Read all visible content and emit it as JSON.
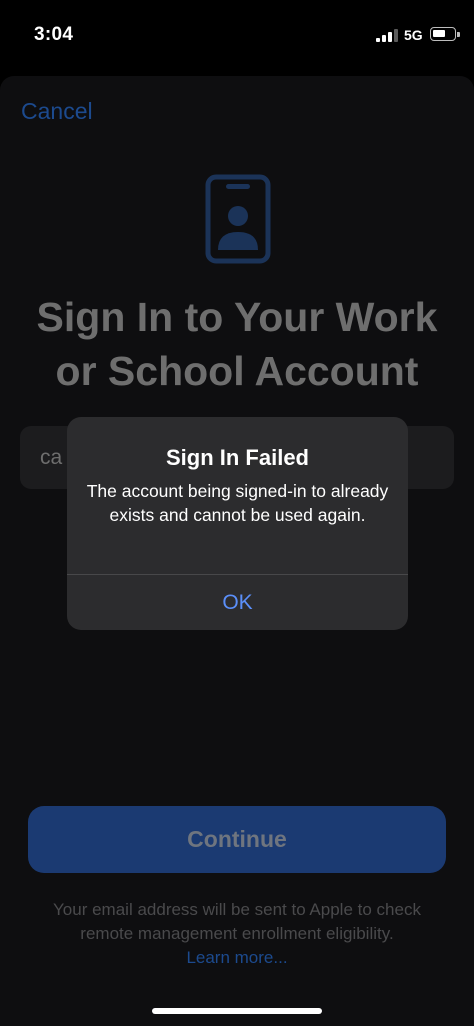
{
  "status_bar": {
    "time": "3:04",
    "network": "5G",
    "signal_bars_active": 3,
    "signal_bars_total": 4
  },
  "sheet": {
    "cancel_label": "Cancel",
    "icon": "person-badge-icon",
    "title_line1": "Sign In to Your Work",
    "title_line2": "or School Account",
    "email_value": "ca",
    "continue_label": "Continue",
    "footer_line1": "Your email address will be sent to Apple to check",
    "footer_line2": "remote management enrollment eligibility.",
    "learn_more": "Learn more..."
  },
  "alert": {
    "title": "Sign In Failed",
    "message": "The account being signed-in to already exists and cannot be used again.",
    "ok_label": "OK"
  },
  "colors": {
    "accent": "#5b8ff9",
    "dimmed_accent": "#1c4a8e",
    "button_bg": "#1b3a72",
    "alert_bg": "#2c2c2e"
  }
}
